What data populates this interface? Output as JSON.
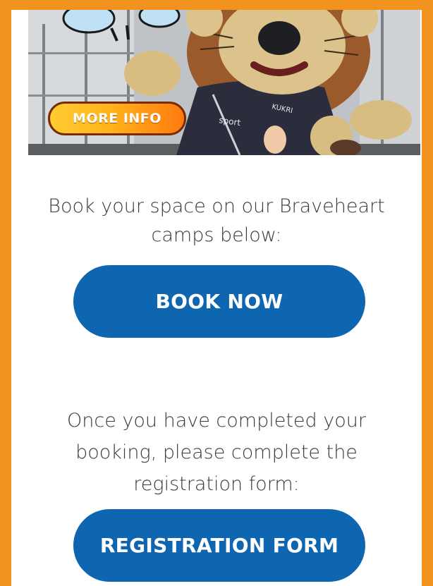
{
  "hero": {
    "more_info_label": "MORE INFO"
  },
  "intro": {
    "line1": "Book your space on our Braveheart",
    "line2": "camps below:"
  },
  "book_button": {
    "label": "BOOK NOW"
  },
  "note": {
    "line1": "Once you have completed your",
    "line2": "booking, please complete the",
    "line3": "registration form:"
  },
  "registration_button": {
    "label": "REGISTRATION FORM"
  },
  "colors": {
    "page_border": "#f3931f",
    "button_blue": "#0e66b1",
    "text": "#3a3a3a"
  }
}
